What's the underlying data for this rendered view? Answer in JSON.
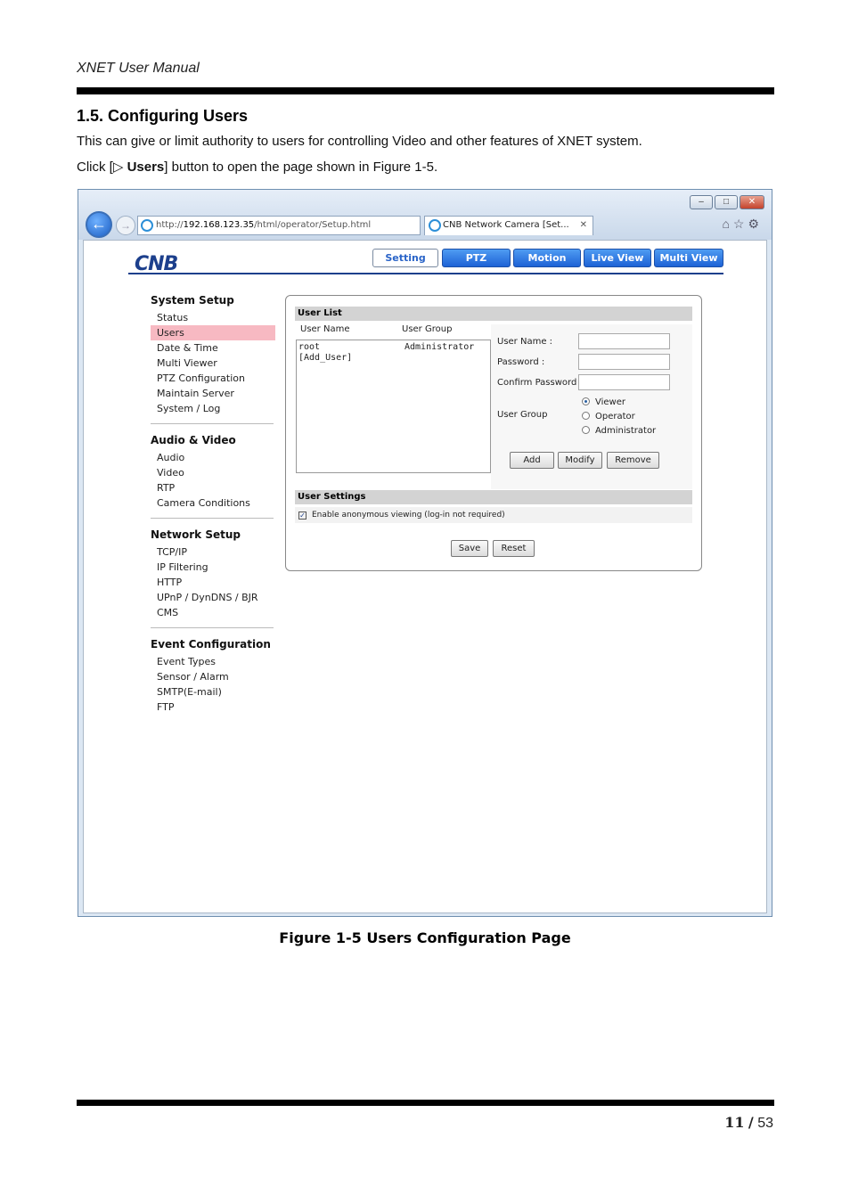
{
  "doc": {
    "header": "XNET User Manual",
    "section_title": "1.5. Configuring Users",
    "para1": "This can give or limit authority to users for controlling Video and other features of XNET system.",
    "para2_pre": "Click [",
    "para2_arrow": "▷",
    "para2_bold": "Users",
    "para2_post": "] button to open the page shown in Figure 1-5.",
    "caption": "Figure 1-5 Users Configuration Page",
    "page_current": "11",
    "page_sep": "/",
    "page_total": "53"
  },
  "browser": {
    "url_prefix": "http://",
    "url_host": "192.168.123.35",
    "url_path": "/html/operator/Setup.html",
    "tab_title": "CNB Network Camera [Set...",
    "logo": "CNB"
  },
  "nav": [
    "Setting",
    "PTZ",
    "Motion",
    "Live View",
    "Multi View"
  ],
  "sidebar": {
    "groups": [
      {
        "title": "System Setup",
        "items": [
          "Status",
          "Users",
          "Date & Time",
          "Multi Viewer",
          "PTZ Configuration",
          "Maintain Server",
          "System / Log"
        ]
      },
      {
        "title": "Audio & Video",
        "items": [
          "Audio",
          "Video",
          "RTP",
          "Camera Conditions"
        ]
      },
      {
        "title": "Network Setup",
        "items": [
          "TCP/IP",
          "IP Filtering",
          "HTTP",
          "UPnP / DynDNS / BJR",
          "CMS"
        ]
      },
      {
        "title": "Event Configuration",
        "items": [
          "Event Types",
          "Sensor / Alarm",
          "SMTP(E-mail)",
          "FTP"
        ]
      }
    ]
  },
  "panel": {
    "user_list_title": "User List",
    "col_user_name": "User Name",
    "col_user_group": "User Group",
    "rows": [
      {
        "name": "root",
        "group": "Administrator"
      },
      {
        "name": "[Add_User]",
        "group": ""
      }
    ],
    "label_user_name": "User Name :",
    "label_password": "Password :",
    "label_confirm": "Confirm Password :",
    "label_group": "User Group",
    "radio_viewer": "Viewer",
    "radio_operator": "Operator",
    "radio_admin": "Administrator",
    "btn_add": "Add",
    "btn_modify": "Modify",
    "btn_remove": "Remove",
    "settings_title": "User Settings",
    "anonymous": "Enable anonymous viewing (log-in not required)",
    "btn_save": "Save",
    "btn_reset": "Reset"
  }
}
